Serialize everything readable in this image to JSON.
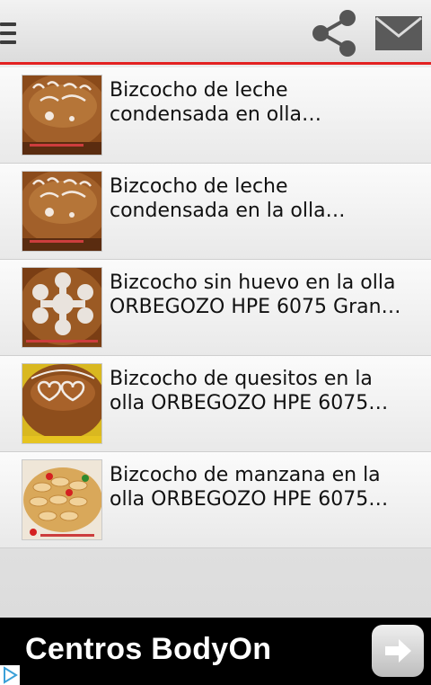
{
  "header": {
    "menu_icon": "hamburger-menu-icon",
    "share_icon": "share-icon",
    "mail_icon": "mail-icon",
    "accent_color": "#e32222"
  },
  "list": {
    "items": [
      {
        "title": "Bizcocho de leche\ncondensada en olla…",
        "image": "birthday-cake-thumbnail"
      },
      {
        "title": "Bizcocho de leche\ncondensada en la olla…",
        "image": "birthday-cake-thumbnail"
      },
      {
        "title": "Bizcocho sin huevo en la olla\nORBEGOZO HPE 6075 Gran…",
        "image": "snowflake-cake-thumbnail"
      },
      {
        "title": "Bizcocho de quesitos en la\nolla ORBEGOZO HPE 6075…",
        "image": "hearts-cake-thumbnail"
      },
      {
        "title": "Bizcocho de manzana en la\nolla ORBEGOZO HPE 6075…",
        "image": "apple-cake-thumbnail"
      }
    ]
  },
  "ad": {
    "text": "Centros BodyOn",
    "button_icon": "arrow-right-icon",
    "adchoices_icon": "adchoices-icon"
  }
}
